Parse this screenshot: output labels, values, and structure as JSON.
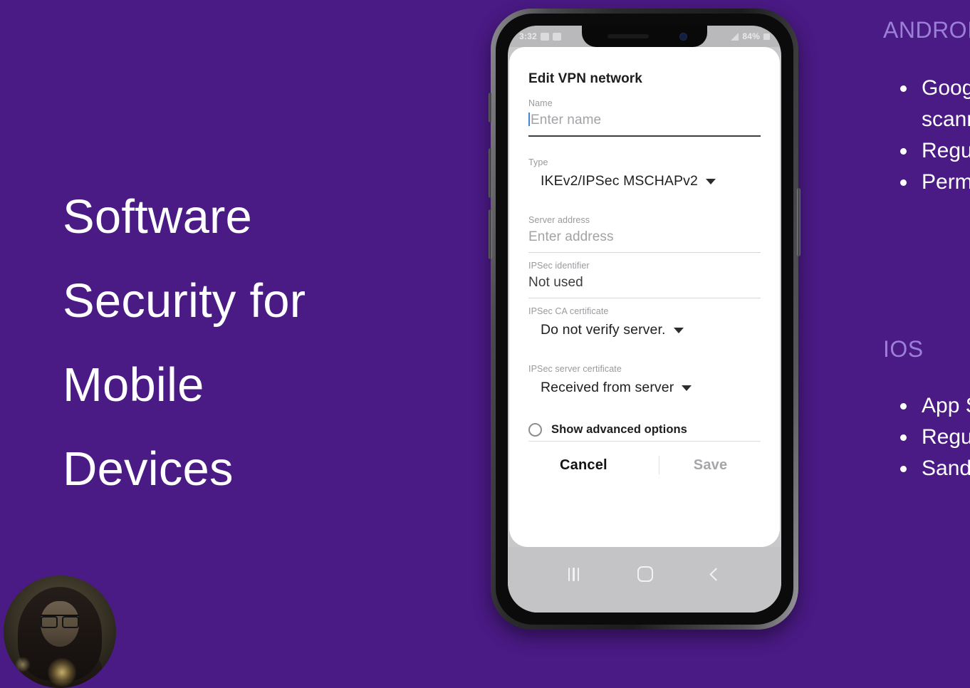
{
  "slide": {
    "background_color": "#4A1A85",
    "title": "Software\nSecurity for\nMobile\nDevices",
    "title_color": "#FFFFFF"
  },
  "right_column": {
    "heading_color": "#9C7FD8",
    "sections": [
      {
        "heading": "ANDROID",
        "bullets": [
          "Google Play Protect\nscanning",
          "Regular updates",
          "Permissions"
        ]
      },
      {
        "heading": "IOS",
        "bullets": [
          "App Store review",
          "Regular updates",
          "Sandboxing"
        ]
      }
    ]
  },
  "phone": {
    "status_bar": {
      "time": "3:32",
      "battery_percent": "84%",
      "icons": [
        "image-icon",
        "calendar-icon",
        "signal-icon",
        "battery-icon"
      ]
    },
    "dialog": {
      "title": "Edit VPN network",
      "fields": [
        {
          "label": "Name",
          "value": "Enter name",
          "kind": "text-input",
          "is_placeholder": true,
          "focused": true
        },
        {
          "label": "Type",
          "value": "IKEv2/IPSec MSCHAPv2",
          "kind": "select"
        },
        {
          "label": "Server address",
          "value": "Enter address",
          "kind": "text-input",
          "is_placeholder": true,
          "focused": false
        },
        {
          "label": "IPSec identifier",
          "value": "Not used",
          "kind": "text-input",
          "is_placeholder": false,
          "focused": false
        },
        {
          "label": "IPSec CA certificate",
          "value": "Do not verify server.",
          "kind": "select"
        },
        {
          "label": "IPSec server certificate",
          "value": "Received from server",
          "kind": "select"
        }
      ],
      "advanced": {
        "label": "Show advanced options",
        "checked": false
      },
      "actions": {
        "cancel": "Cancel",
        "save": "Save",
        "save_enabled": false
      }
    },
    "nav_bar": {
      "recents": "recents-icon",
      "home": "home-icon",
      "back": "back-icon"
    }
  },
  "webcam": {
    "label": "presenter-webcam"
  }
}
